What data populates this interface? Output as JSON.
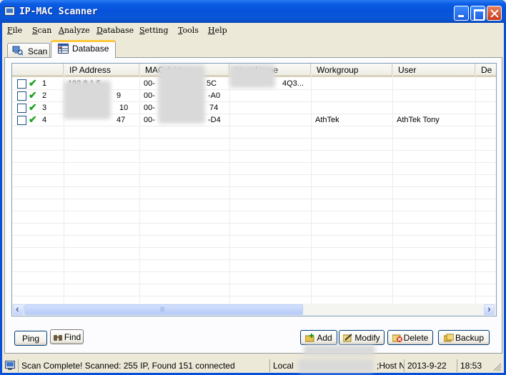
{
  "window": {
    "title": "IP-MAC Scanner"
  },
  "menu": [
    "File",
    "Scan",
    "Analyze",
    "Database",
    "Setting",
    "Tools",
    "Help"
  ],
  "tabs": [
    {
      "label": "Scan",
      "icon": "scan-icon",
      "active": false
    },
    {
      "label": "Database",
      "icon": "database-icon",
      "active": true
    }
  ],
  "table": {
    "columns": [
      "IP Address",
      "MAC Address",
      "Host Name",
      "Workgroup",
      "User",
      "De"
    ],
    "rows": [
      {
        "num": "1",
        "ip": "192 8 1.5",
        "mac_start": "00-",
        "mac_end": "5C",
        "host": "4Q3...",
        "workgroup": "",
        "user": ""
      },
      {
        "num": "2",
        "ip": "9",
        "mac_start": "00-",
        "mac_end": "-A0",
        "host": "",
        "workgroup": "",
        "user": ""
      },
      {
        "num": "3",
        "ip": "10",
        "mac_start": "00-",
        "mac_end": "74",
        "host": "",
        "workgroup": "",
        "user": ""
      },
      {
        "num": "4",
        "ip": "47",
        "mac_start": "00-",
        "mac_end": "-D4",
        "host": "",
        "workgroup": "AthTek",
        "user": "AthTek Tony"
      }
    ]
  },
  "buttons": {
    "ping": "Ping",
    "find": "Find",
    "add": "Add",
    "modify": "Modify",
    "delete": "Delete",
    "backup": "Backup"
  },
  "status": {
    "message": "Scan Complete! Scanned: 255 IP, Found 151 connected",
    "local": "Local",
    "host": ";Host N",
    "date": "2013-9-22",
    "time": "18:53"
  },
  "colors": {
    "titlebar": "#0653db",
    "active_tab_accent": "#ffc83c",
    "tick": "#1fa31f"
  }
}
